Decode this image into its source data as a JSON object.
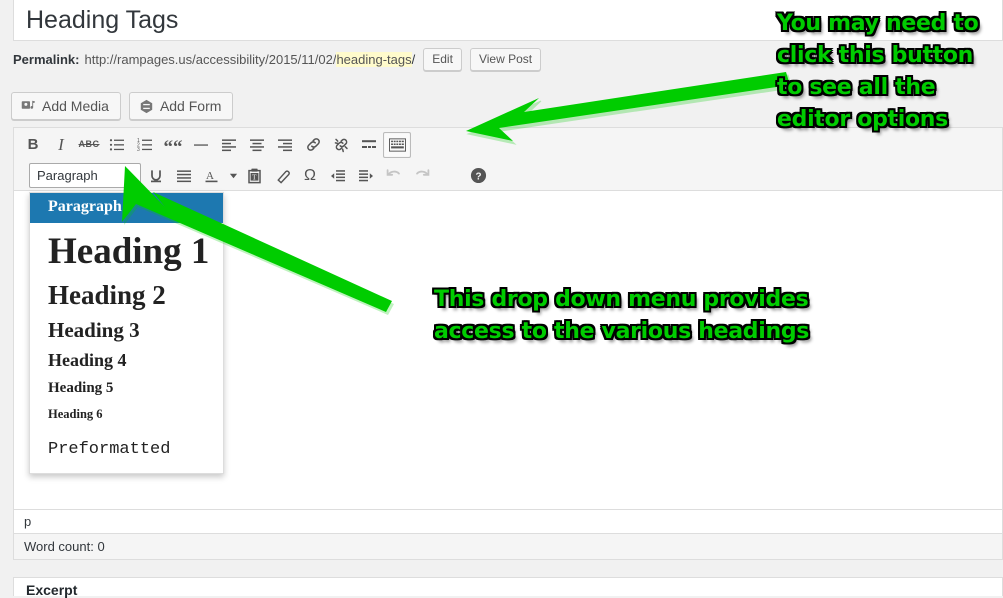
{
  "post": {
    "title": "Heading Tags",
    "permalink_label": "Permalink:",
    "permalink_url": "http://rampages.us/accessibility/2015/11/02/",
    "permalink_slug": "heading-tags",
    "permalink_trail": "/",
    "edit_button": "Edit",
    "view_post_button": "View Post"
  },
  "media_buttons": [
    {
      "label": "Add Media",
      "icon": "add-media-icon"
    },
    {
      "label": "Add Form",
      "icon": "add-form-icon"
    }
  ],
  "toolbar": {
    "row1": [
      {
        "name": "bold",
        "label": "B",
        "kind": "text"
      },
      {
        "name": "italic",
        "label": "I",
        "kind": "text-italic"
      },
      {
        "name": "strikethrough",
        "label": "ABC",
        "kind": "text-strike"
      },
      {
        "name": "bullet-list",
        "label": "",
        "kind": "icon"
      },
      {
        "name": "numbered-list",
        "label": "",
        "kind": "icon"
      },
      {
        "name": "blockquote",
        "label": "““",
        "kind": "text-quote"
      },
      {
        "name": "horizontal-rule",
        "label": "",
        "kind": "icon"
      },
      {
        "name": "align-left",
        "label": "",
        "kind": "icon"
      },
      {
        "name": "align-center",
        "label": "",
        "kind": "icon"
      },
      {
        "name": "align-right",
        "label": "",
        "kind": "icon"
      },
      {
        "name": "insert-link",
        "label": "",
        "kind": "icon"
      },
      {
        "name": "remove-link",
        "label": "",
        "kind": "icon"
      },
      {
        "name": "read-more",
        "label": "",
        "kind": "icon"
      },
      {
        "name": "toggle-toolbar",
        "label": "",
        "kind": "icon",
        "active": true
      }
    ],
    "row2": [
      {
        "name": "underline",
        "label": "",
        "kind": "icon"
      },
      {
        "name": "align-justify",
        "label": "",
        "kind": "icon"
      },
      {
        "name": "text-color",
        "label": "A",
        "kind": "color"
      },
      {
        "name": "paste-as-text",
        "label": "",
        "kind": "icon"
      },
      {
        "name": "clear-formatting",
        "label": "",
        "kind": "icon"
      },
      {
        "name": "special-character",
        "label": "Ω",
        "kind": "text-omega"
      },
      {
        "name": "outdent",
        "label": "",
        "kind": "icon"
      },
      {
        "name": "indent",
        "label": "",
        "kind": "icon"
      },
      {
        "name": "undo",
        "label": "",
        "kind": "icon",
        "disabled": true
      },
      {
        "name": "redo",
        "label": "",
        "kind": "icon",
        "disabled": true
      },
      {
        "name": "keyboard-shortcuts",
        "label": "",
        "kind": "icon"
      }
    ],
    "format_select": {
      "value": "Paragraph",
      "caret": "▲",
      "options": [
        {
          "label": "Paragraph",
          "style": "sel"
        },
        {
          "label": "Heading 1",
          "style": "fm-h1"
        },
        {
          "label": "Heading 2",
          "style": "fm-h2"
        },
        {
          "label": "Heading 3",
          "style": "fm-h3"
        },
        {
          "label": "Heading 4",
          "style": "fm-h4"
        },
        {
          "label": "Heading 5",
          "style": "fm-h5"
        },
        {
          "label": "Heading 6",
          "style": "fm-h6"
        },
        {
          "label": "Preformatted",
          "style": "fm-pre"
        }
      ]
    }
  },
  "status": {
    "element_path": "p",
    "word_count": "Word count: 0"
  },
  "excerpt": {
    "title": "Excerpt"
  },
  "annotations": [
    {
      "id": "anno-1",
      "text": "You may need to\nclick this button\nto see all the\neditor options"
    },
    {
      "id": "anno-2",
      "text": "This drop down menu provides\naccess to the various headings"
    }
  ],
  "colors": {
    "annotation_green": "#00cc00",
    "selected_row_blue": "#1d78b0",
    "slug_highlight": "#fffbcc"
  }
}
